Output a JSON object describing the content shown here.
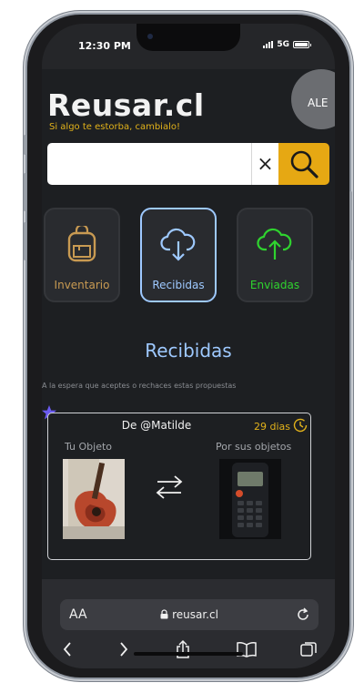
{
  "status": {
    "time": "12:30 PM",
    "network": "5G"
  },
  "header": {
    "brand": "Reusar.cl",
    "tagline": "Si algo te estorba, cambialo!",
    "user": "ALE"
  },
  "search": {
    "value": "",
    "placeholder": "",
    "clear_symbol": "×"
  },
  "tiles": [
    {
      "label": "Inventario",
      "icon": "backpack-icon",
      "color": "#c89a52"
    },
    {
      "label": "Recibidas",
      "icon": "cloud-download-icon",
      "color": "#9ec9ff",
      "selected": true
    },
    {
      "label": "Enviadas",
      "icon": "cloud-upload-icon",
      "color": "#2fd32f"
    }
  ],
  "section": {
    "title": "Recibidas",
    "subtitle": "A la espera que aceptes o rechaces estas propuestas"
  },
  "proposal": {
    "from": "De @Matilde",
    "days": "29 dias",
    "yours_label": "Tu Objeto",
    "theirs_label": "Por sus objetos",
    "yours_image": "guitar-photo",
    "theirs_image": "radio-photo"
  },
  "browser": {
    "aa": "AA",
    "url": "reusar.cl"
  },
  "colors": {
    "accent": "#e6a813",
    "selected": "#9ec9ff",
    "sent": "#2fd32f",
    "inventory": "#c89a52",
    "background": "#1d1f22"
  }
}
